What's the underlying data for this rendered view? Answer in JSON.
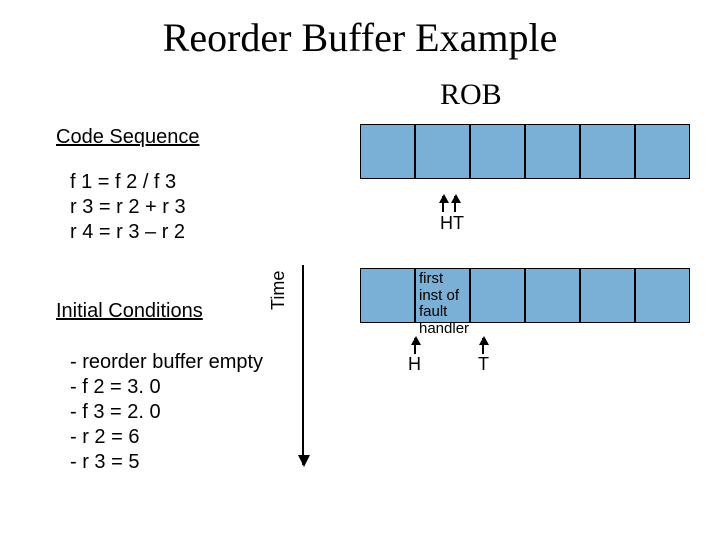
{
  "title": "Reorder Buffer Example",
  "rob_label": "ROB",
  "code_sequence": {
    "header": "Code Sequence",
    "lines": [
      "f 1 = f 2 / f 3",
      "r 3 = r 2 + r 3",
      "r 4 = r 3 – r 2"
    ]
  },
  "initial_conditions": {
    "header": "Initial Conditions",
    "lines": [
      "- reorder buffer empty",
      "- f 2 = 3. 0",
      "- f 3 = 2. 0",
      "- r 2 = 6",
      "- r 3 = 5"
    ]
  },
  "time_label": "Time",
  "top_rob": {
    "ht_label": "HT",
    "cells": [
      "",
      "",
      "",
      "",
      "",
      ""
    ]
  },
  "bottom_rob": {
    "cells": [
      {
        "text": ""
      },
      {
        "text": "first inst of fault handler"
      },
      {
        "text": ""
      },
      {
        "text": ""
      },
      {
        "text": ""
      },
      {
        "text": ""
      }
    ],
    "h_label": "H",
    "t_label": "T"
  }
}
